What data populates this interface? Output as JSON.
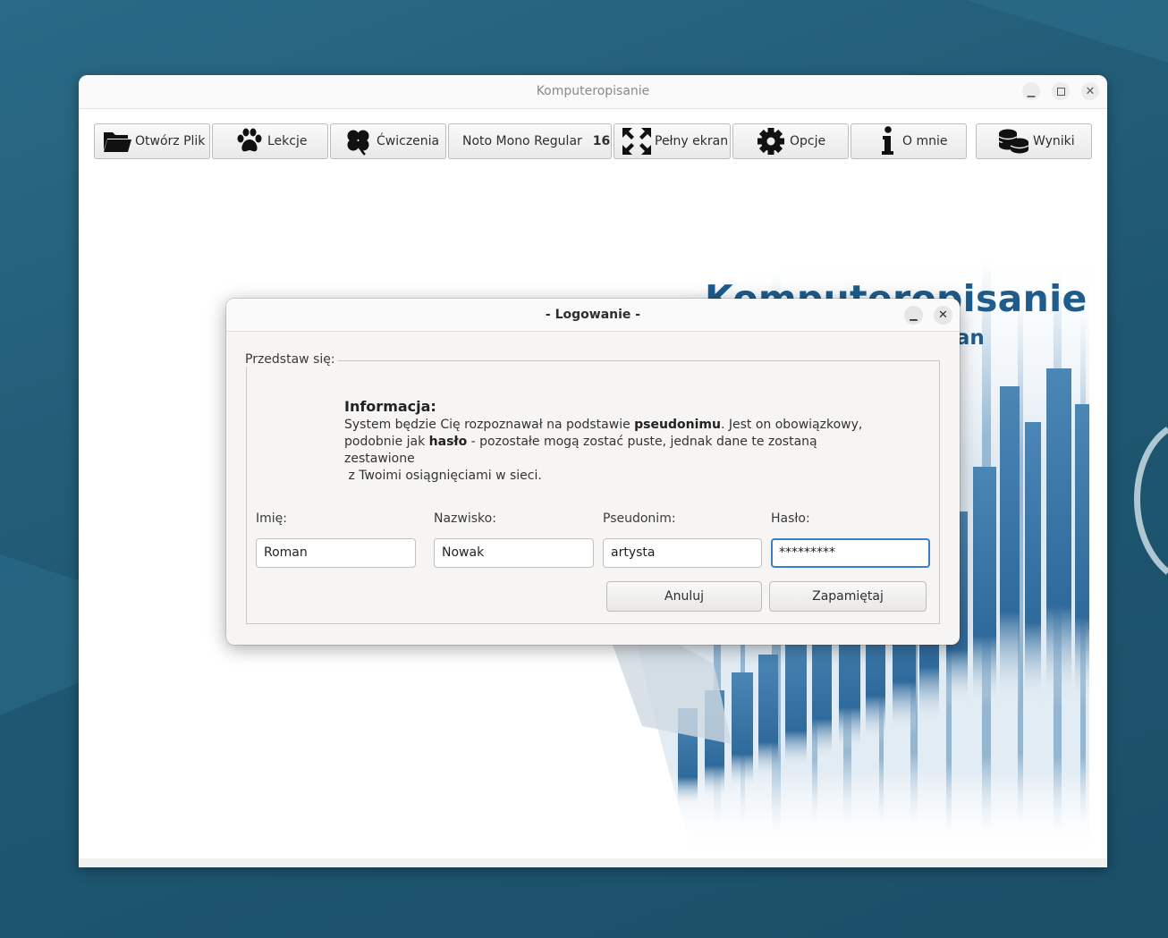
{
  "window": {
    "title": "Komputeropisanie",
    "minimize_icon": "minimize-icon",
    "maximize_icon": "maximize-icon",
    "close_icon": "close-icon"
  },
  "toolbar": {
    "open_file": {
      "label": "Otwórz Plik",
      "icon": "folder-icon"
    },
    "lessons": {
      "label": "Lekcje",
      "icon": "paw-icon"
    },
    "exercises": {
      "label": "Ćwiczenia",
      "icon": "clover-icon"
    },
    "font": {
      "name": "Noto Mono Regular",
      "size": "16"
    },
    "fullscreen": {
      "label": "Pełny ekran",
      "icon": "fullscreen-icon"
    },
    "options": {
      "label": "Opcje",
      "icon": "gear-icon"
    },
    "about": {
      "label": "O mnie",
      "icon": "info-icon"
    },
    "results": {
      "label": "Wyniki",
      "icon": "coins-icon"
    }
  },
  "hero": {
    "title": "Komputeropisanie",
    "author": "© Nowak Roman"
  },
  "dialog": {
    "title": "- Logowanie -",
    "group_label": "Przedstaw się:",
    "info": {
      "title": "Informacja:",
      "line1_pre": "System będzie Cię rozpoznawał na podstawie ",
      "line1_bold": "pseudonimu",
      "line1_post": ". Jest on obowiązkowy,",
      "line2_pre": "podobnie jak ",
      "line2_bold": "hasło",
      "line2_post": " - pozostałe mogą zostać puste, jednak dane te zostaną zestawione",
      "line3": " z Twoimi osiągnięciami w sieci."
    },
    "fields": {
      "first_name": {
        "label": "Imię:",
        "value": "Roman"
      },
      "last_name": {
        "label": "Nazwisko:",
        "value": "Nowak"
      },
      "nickname": {
        "label": "Pseudonim:",
        "value": "artysta"
      },
      "password": {
        "label": "Hasło:",
        "value": "*********"
      }
    },
    "buttons": {
      "cancel": "Anuluj",
      "save": "Zapamiętaj"
    }
  },
  "colors": {
    "accent": "#1e5c8c",
    "focus": "#3d7fc4",
    "desktop": "#1f5873"
  }
}
